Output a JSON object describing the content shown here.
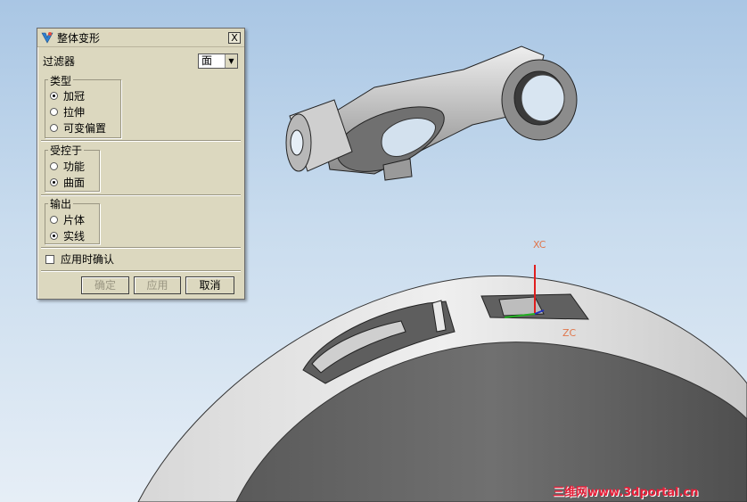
{
  "dialog": {
    "title": "整体变形",
    "close_label": "X",
    "filter": {
      "label": "过滤器",
      "value": "面"
    },
    "type_group": {
      "label": "类型",
      "options": [
        "加冠",
        "拉伸",
        "可变偏置"
      ],
      "selected": "加冠"
    },
    "controlled_by_group": {
      "label": "受控于",
      "options": [
        "功能",
        "曲面"
      ],
      "selected": "曲面"
    },
    "output_group": {
      "label": "输出",
      "options": [
        "片体",
        "实线"
      ],
      "selected": "实线"
    },
    "confirm_on_apply": {
      "label": "应用时确认",
      "checked": false
    },
    "buttons": {
      "ok": "确定",
      "apply": "应用",
      "cancel": "取消"
    }
  },
  "viewport": {
    "axis_labels": {
      "xc": "XC",
      "zc": "ZC"
    },
    "watermark": "三维网www.3dportal.cn"
  },
  "colors": {
    "background_top": "#a9c6e4",
    "dialog_bg": "#dcd8bf",
    "axis_x": "#e0764b",
    "watermark": "#e5203a"
  }
}
